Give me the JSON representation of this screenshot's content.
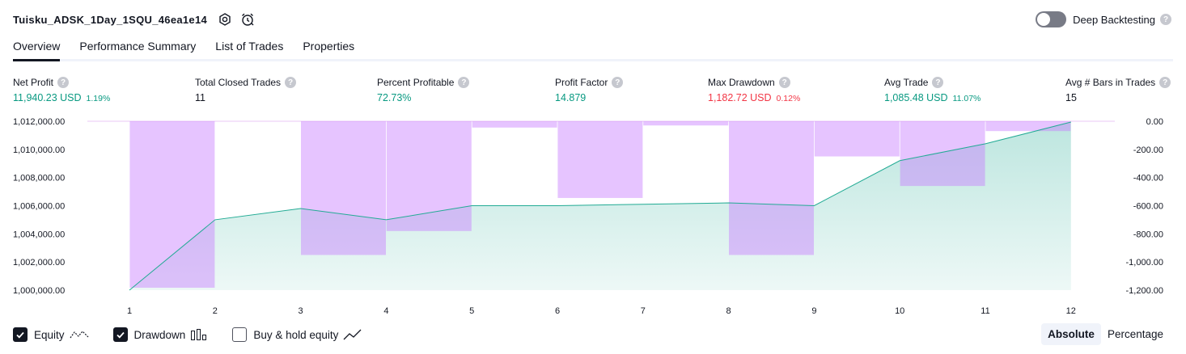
{
  "header": {
    "strategy_name": "Tuisku_ADSK_1Day_1SQU_46ea1e14",
    "deep_backtesting_label": "Deep Backtesting",
    "deep_backtesting_enabled": false,
    "help_glyph": "?"
  },
  "tabs": [
    {
      "label": "Overview",
      "active": true
    },
    {
      "label": "Performance Summary",
      "active": false
    },
    {
      "label": "List of Trades",
      "active": false
    },
    {
      "label": "Properties",
      "active": false
    }
  ],
  "metrics": {
    "net_profit": {
      "label": "Net Profit",
      "value": "11,940.23 USD",
      "pct": "1.19%"
    },
    "total_closed_trades": {
      "label": "Total Closed Trades",
      "value": "11"
    },
    "percent_profitable": {
      "label": "Percent Profitable",
      "value": "72.73%"
    },
    "profit_factor": {
      "label": "Profit Factor",
      "value": "14.879"
    },
    "max_drawdown": {
      "label": "Max Drawdown",
      "value": "1,182.72 USD",
      "pct": "0.12%"
    },
    "avg_trade": {
      "label": "Avg Trade",
      "value": "1,085.48 USD",
      "pct": "11.07%"
    },
    "avg_bars_in_trades": {
      "label": "Avg # Bars in Trades",
      "value": "15"
    }
  },
  "colors": {
    "positive": "#089981",
    "negative": "#f23645",
    "equity_line": "#22ab94",
    "drawdown_bar": "#c77dff",
    "text": "#131722"
  },
  "chart_data": {
    "type": "line+bar",
    "x": [
      1,
      2,
      3,
      4,
      5,
      6,
      7,
      8,
      9,
      10,
      11,
      12
    ],
    "left_axis": {
      "ticks": [
        "1,012,000.00",
        "1,010,000.00",
        "1,008,000.00",
        "1,006,000.00",
        "1,004,000.00",
        "1,002,000.00",
        "1,000,000.00"
      ],
      "tick_values": [
        1012000,
        1010000,
        1008000,
        1006000,
        1004000,
        1002000,
        1000000
      ],
      "ylim": [
        1000000,
        1012000
      ]
    },
    "right_axis": {
      "ticks": [
        "0.00",
        "-200.00",
        "-400.00",
        "-600.00",
        "-800.00",
        "-1,000.00",
        "-1,200.00"
      ],
      "tick_values": [
        0,
        -200,
        -400,
        -600,
        -800,
        -1000,
        -1200
      ],
      "ylim": [
        -1200,
        0
      ]
    },
    "series": [
      {
        "name": "Equity",
        "kind": "line-area",
        "values": [
          1000000,
          1005000,
          1005800,
          1005000,
          1006000,
          1006000,
          1006100,
          1006200,
          1006000,
          1009200,
          1010400,
          1011940
        ]
      },
      {
        "name": "Drawdown",
        "kind": "bar",
        "values": [
          0,
          -1183,
          0,
          -950,
          -780,
          -45,
          -545,
          -30,
          -950,
          -250,
          -460,
          -70
        ]
      }
    ]
  },
  "legend": {
    "items": [
      {
        "label": "Equity",
        "checked": true,
        "icon": "equity-line-icon"
      },
      {
        "label": "Drawdown",
        "checked": true,
        "icon": "drawdown-bars-icon"
      },
      {
        "label": "Buy & hold equity",
        "checked": false,
        "icon": "buy-hold-line-icon"
      }
    ]
  },
  "view_mode": {
    "options": [
      "Absolute",
      "Percentage"
    ],
    "selected": "Absolute"
  }
}
